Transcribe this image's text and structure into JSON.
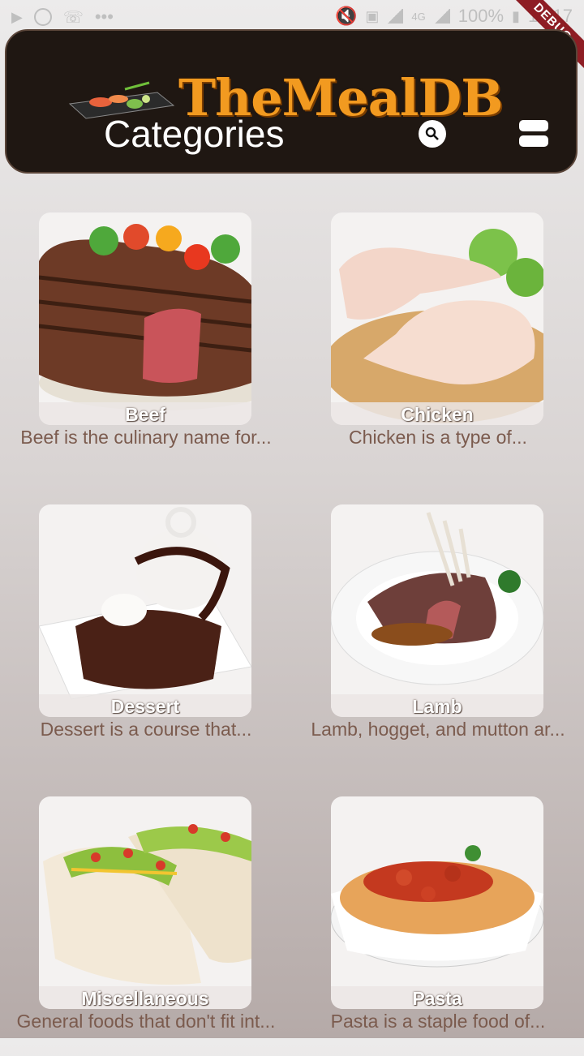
{
  "status": {
    "time": "12:17",
    "battery": "100%",
    "network": "4G",
    "debug_label": "DEBUG"
  },
  "appbar": {
    "logo_text": "TheMealDB",
    "title": "Categories"
  },
  "categories": [
    {
      "name": "Beef",
      "description": "Beef is the culinary name for..."
    },
    {
      "name": "Chicken",
      "description": "Chicken is a type of..."
    },
    {
      "name": "Dessert",
      "description": "Dessert is a course that..."
    },
    {
      "name": "Lamb",
      "description": "Lamb, hogget, and mutton ar..."
    },
    {
      "name": "Miscellaneous",
      "description": "General foods that don't fit int..."
    },
    {
      "name": "Pasta",
      "description": "Pasta is a staple food of..."
    }
  ],
  "colors": {
    "appbar_bg": "#1f1712",
    "logo": "#f29a20",
    "description_text": "#7b5b4e"
  }
}
